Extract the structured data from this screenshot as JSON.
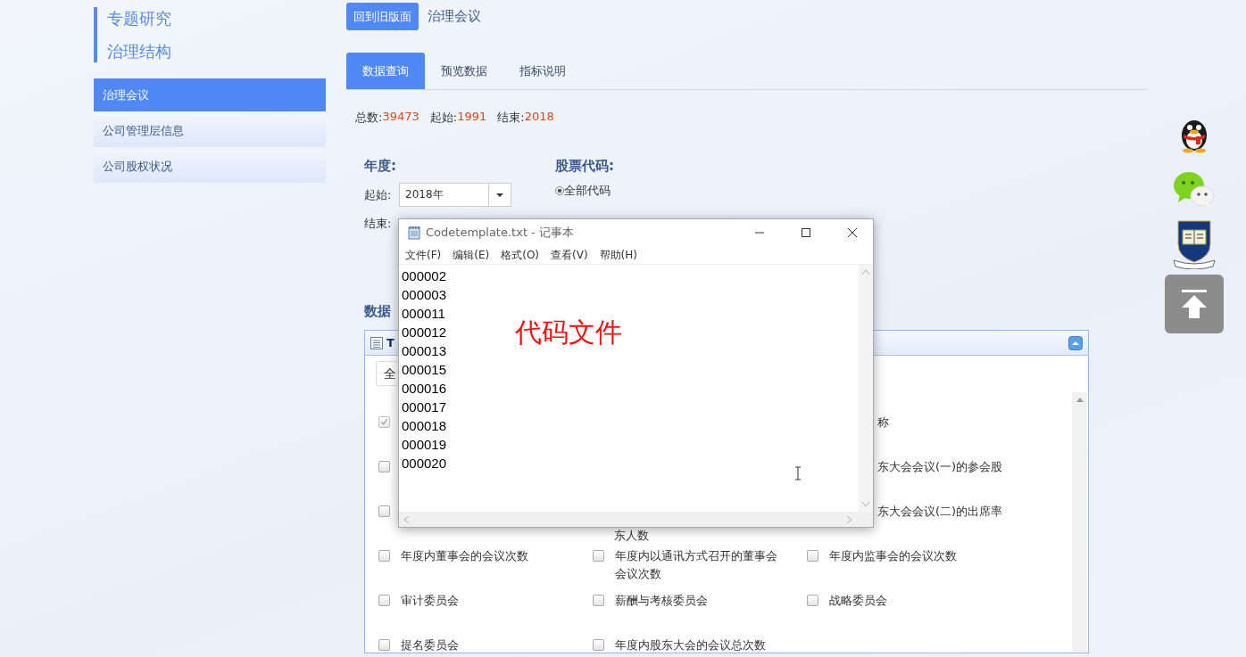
{
  "sidebar": {
    "headings": [
      "专题研究",
      "治理结构"
    ],
    "items": [
      {
        "label": "治理会议",
        "selected": true
      },
      {
        "label": "公司管理层信息",
        "selected": false
      },
      {
        "label": "公司股权状况",
        "selected": false
      }
    ]
  },
  "header": {
    "back_button": "回到旧版面",
    "title": "治理会议"
  },
  "tabs": [
    {
      "label": "数据查询",
      "selected": true
    },
    {
      "label": "预览数据",
      "selected": false
    },
    {
      "label": "指标说明",
      "selected": false
    }
  ],
  "stats": [
    {
      "label": "总数:",
      "value": "39473"
    },
    {
      "label": "起始:",
      "value": "1991"
    },
    {
      "label": "结束:",
      "value": "2018"
    }
  ],
  "year_filter": {
    "title": "年度:",
    "start_label": "起始:",
    "start_value": "2018年",
    "end_label": "结束:"
  },
  "code_filter": {
    "title": "股票代码:",
    "options": [
      {
        "label": "全部代码",
        "selected": true
      }
    ]
  },
  "indicators": {
    "title": "数据",
    "panel_title": "T",
    "select_value": "全",
    "cells": [
      {
        "kind": "checkbox",
        "checked": true,
        "disabled": true
      },
      {
        "kind": "empty"
      },
      {
        "kind": "tail",
        "label": "称"
      },
      {
        "kind": "checkbox",
        "checked": false,
        "disabled": false
      },
      {
        "kind": "empty"
      },
      {
        "kind": "tail",
        "label": "东大会会议(一)的参会股"
      },
      {
        "kind": "checkbox",
        "checked": false,
        "disabled": false
      },
      {
        "kind": "lower",
        "label": "东人数"
      },
      {
        "kind": "tail",
        "label": "东大会会议(二)的出席率"
      },
      {
        "kind": "full",
        "checked": false,
        "disabled": false,
        "label": "年度内董事会的会议次数"
      },
      {
        "kind": "full",
        "checked": false,
        "disabled": false,
        "label": "年度内以通讯方式召开的董事会会议次数"
      },
      {
        "kind": "full",
        "checked": false,
        "disabled": false,
        "label": "年度内监事会的会议次数"
      },
      {
        "kind": "full",
        "checked": false,
        "disabled": false,
        "label": "审计委员会"
      },
      {
        "kind": "full",
        "checked": false,
        "disabled": false,
        "label": "薪酬与考核委员会"
      },
      {
        "kind": "full",
        "checked": false,
        "disabled": false,
        "label": "战略委员会"
      },
      {
        "kind": "full",
        "checked": false,
        "disabled": false,
        "label": "提名委员会"
      },
      {
        "kind": "full",
        "checked": false,
        "disabled": false,
        "label": "年度内股东大会的会议总次数"
      },
      {
        "kind": "empty"
      }
    ]
  },
  "notepad": {
    "title": "Codetemplate.txt - 记事本",
    "menu": [
      "文件(F)",
      "编辑(E)",
      "格式(O)",
      "查看(V)",
      "帮助(H)"
    ],
    "lines": [
      "000002",
      "000003",
      "000011",
      "000012",
      "000013",
      "000015",
      "000016",
      "000017",
      "000018",
      "000019",
      "000020"
    ],
    "annotation": "代码文件"
  }
}
